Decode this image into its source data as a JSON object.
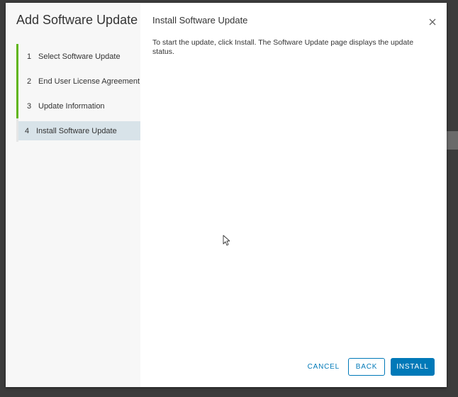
{
  "wizard": {
    "title": "Add Software Update",
    "steps": [
      {
        "number": "1",
        "label": "Select Software Update",
        "state": "completed"
      },
      {
        "number": "2",
        "label": "End User License Agreement",
        "state": "completed"
      },
      {
        "number": "3",
        "label": "Update Information",
        "state": "completed"
      },
      {
        "number": "4",
        "label": "Install Software Update",
        "state": "current"
      }
    ]
  },
  "page": {
    "title": "Install Software Update",
    "description": "To start the update, click Install. The Software Update page displays the update status."
  },
  "footer": {
    "cancel_label": "CANCEL",
    "back_label": "BACK",
    "install_label": "INSTALL"
  },
  "icons": {
    "close": "close-icon",
    "cursor": "mouse-pointer-icon"
  },
  "colors": {
    "accent": "#0079b8",
    "step_complete": "#60b515",
    "step_current_bg": "#d8e3e9",
    "sidebar_bg": "#f7f7f7"
  }
}
